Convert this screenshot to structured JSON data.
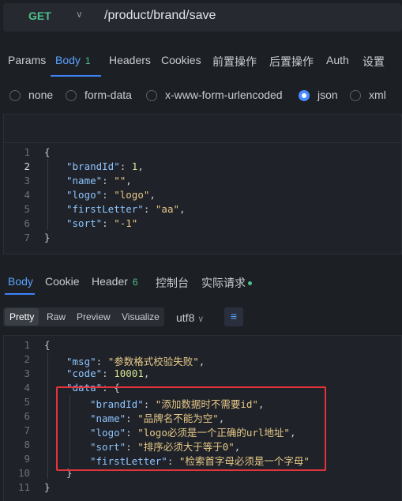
{
  "request": {
    "method": "GET",
    "url": "/product/brand/save"
  },
  "request_tabs": [
    {
      "label": "Params"
    },
    {
      "label": "Body",
      "count": "1"
    },
    {
      "label": "Headers"
    },
    {
      "label": "Cookies"
    },
    {
      "label": "前置操作"
    },
    {
      "label": "后置操作"
    },
    {
      "label": "Auth"
    },
    {
      "label": "设置"
    }
  ],
  "body_types": [
    {
      "label": "none",
      "selected": false
    },
    {
      "label": "form-data",
      "selected": false
    },
    {
      "label": "x-www-form-urlencoded",
      "selected": false
    },
    {
      "label": "json",
      "selected": true
    },
    {
      "label": "xml",
      "selected": false
    }
  ],
  "request_body": {
    "line_numbers": [
      "1",
      "2",
      "3",
      "4",
      "5",
      "6",
      "7"
    ],
    "brandId_key": "\"brandId\"",
    "brandId_val": "1",
    "name_key": "\"name\"",
    "name_val": "\"\"",
    "logo_key": "\"logo\"",
    "logo_val": "\"logo\"",
    "firstLetter_key": "\"firstLetter\"",
    "firstLetter_val": "\"aa\"",
    "sort_key": "\"sort\"",
    "sort_val": "\"-1\""
  },
  "response_tabs": [
    {
      "label": "Body"
    },
    {
      "label": "Cookie"
    },
    {
      "label": "Header",
      "count": "6"
    },
    {
      "label": "控制台"
    },
    {
      "label": "实际请求"
    }
  ],
  "format_buttons": [
    "Pretty",
    "Raw",
    "Preview",
    "Visualize"
  ],
  "encoding": "utf8",
  "response_body": {
    "line_numbers": [
      "1",
      "2",
      "3",
      "4",
      "5",
      "6",
      "7",
      "8",
      "9",
      "10",
      "11"
    ],
    "msg_key": "\"msg\"",
    "msg_val": "\"参数格式校验失败\"",
    "code_key": "\"code\"",
    "code_val": "10001",
    "data_key": "\"data\"",
    "d_brandId_key": "\"brandId\"",
    "d_brandId_val": "\"添加数据时不需要id\"",
    "d_name_key": "\"name\"",
    "d_name_val": "\"品牌名不能为空\"",
    "d_logo_key": "\"logo\"",
    "d_logo_val": "\"logo必须是一个正确的url地址\"",
    "d_sort_key": "\"sort\"",
    "d_sort_val": "\"排序必须大于等于0\"",
    "d_firstLetter_key": "\"firstLetter\"",
    "d_firstLetter_val": "\"检索首字母必须是一个字母\""
  },
  "colors": {
    "accent": "#3e82f7",
    "method_get": "#4fc08d",
    "highlight_box": "#e5333b"
  }
}
